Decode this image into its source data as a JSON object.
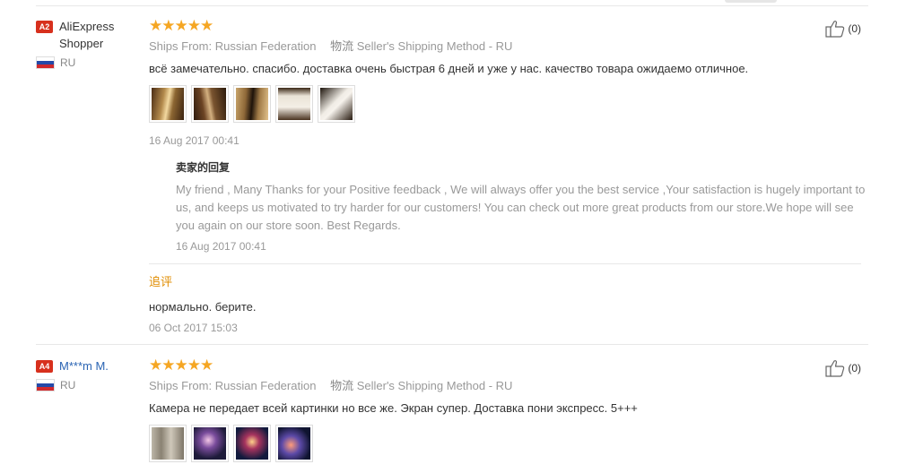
{
  "reviews": [
    {
      "level": "A2",
      "buyer": "AliExpress Shopper",
      "country": "RU",
      "stars": "★★★★★",
      "ships_from_label": "Ships From:",
      "ships_from_value": "Russian Federation",
      "logistics_label": "物流",
      "logistics_value": "Seller's Shipping Method - RU",
      "text": "всё замечательно. спасибо. доставка очень быстрая 6 дней и уже у нас. качество товара ожидаемо отличное.",
      "date": "16 Aug 2017 00:41",
      "helpful_count": "(0)",
      "reply_title": "卖家的回复",
      "reply_text": "My friend , Many Thanks for your Positive feedback , We will always offer you the best service ,Your satisfaction is hugely important to us, and keeps us motivated to try harder for our customers! You can check out more great products from our store.We hope will see you again on our store soon. Best Regards.",
      "reply_date": "16 Aug 2017 00:41",
      "followup_label": "追评",
      "followup_text": "нормально. берите.",
      "followup_date": "06 Oct 2017 15:03"
    },
    {
      "level": "A4",
      "buyer": "M***m M.",
      "country": "RU",
      "stars": "★★★★★",
      "ships_from_label": "Ships From:",
      "ships_from_value": "Russian Federation",
      "logistics_label": "物流",
      "logistics_value": "Seller's Shipping Method - RU",
      "text": "Камера не передает всей картинки но все же. Экран супер. Доставка пони экспресс. 5+++",
      "helpful_count": "(0)"
    }
  ],
  "colors": {
    "star": "#f5a623",
    "badge": "#d7301d",
    "followup": "#e08c00",
    "link": "#2a64b3"
  },
  "icons": {
    "thumbs_up": "thumbs-up-icon",
    "flag": "russia-flag-icon"
  }
}
